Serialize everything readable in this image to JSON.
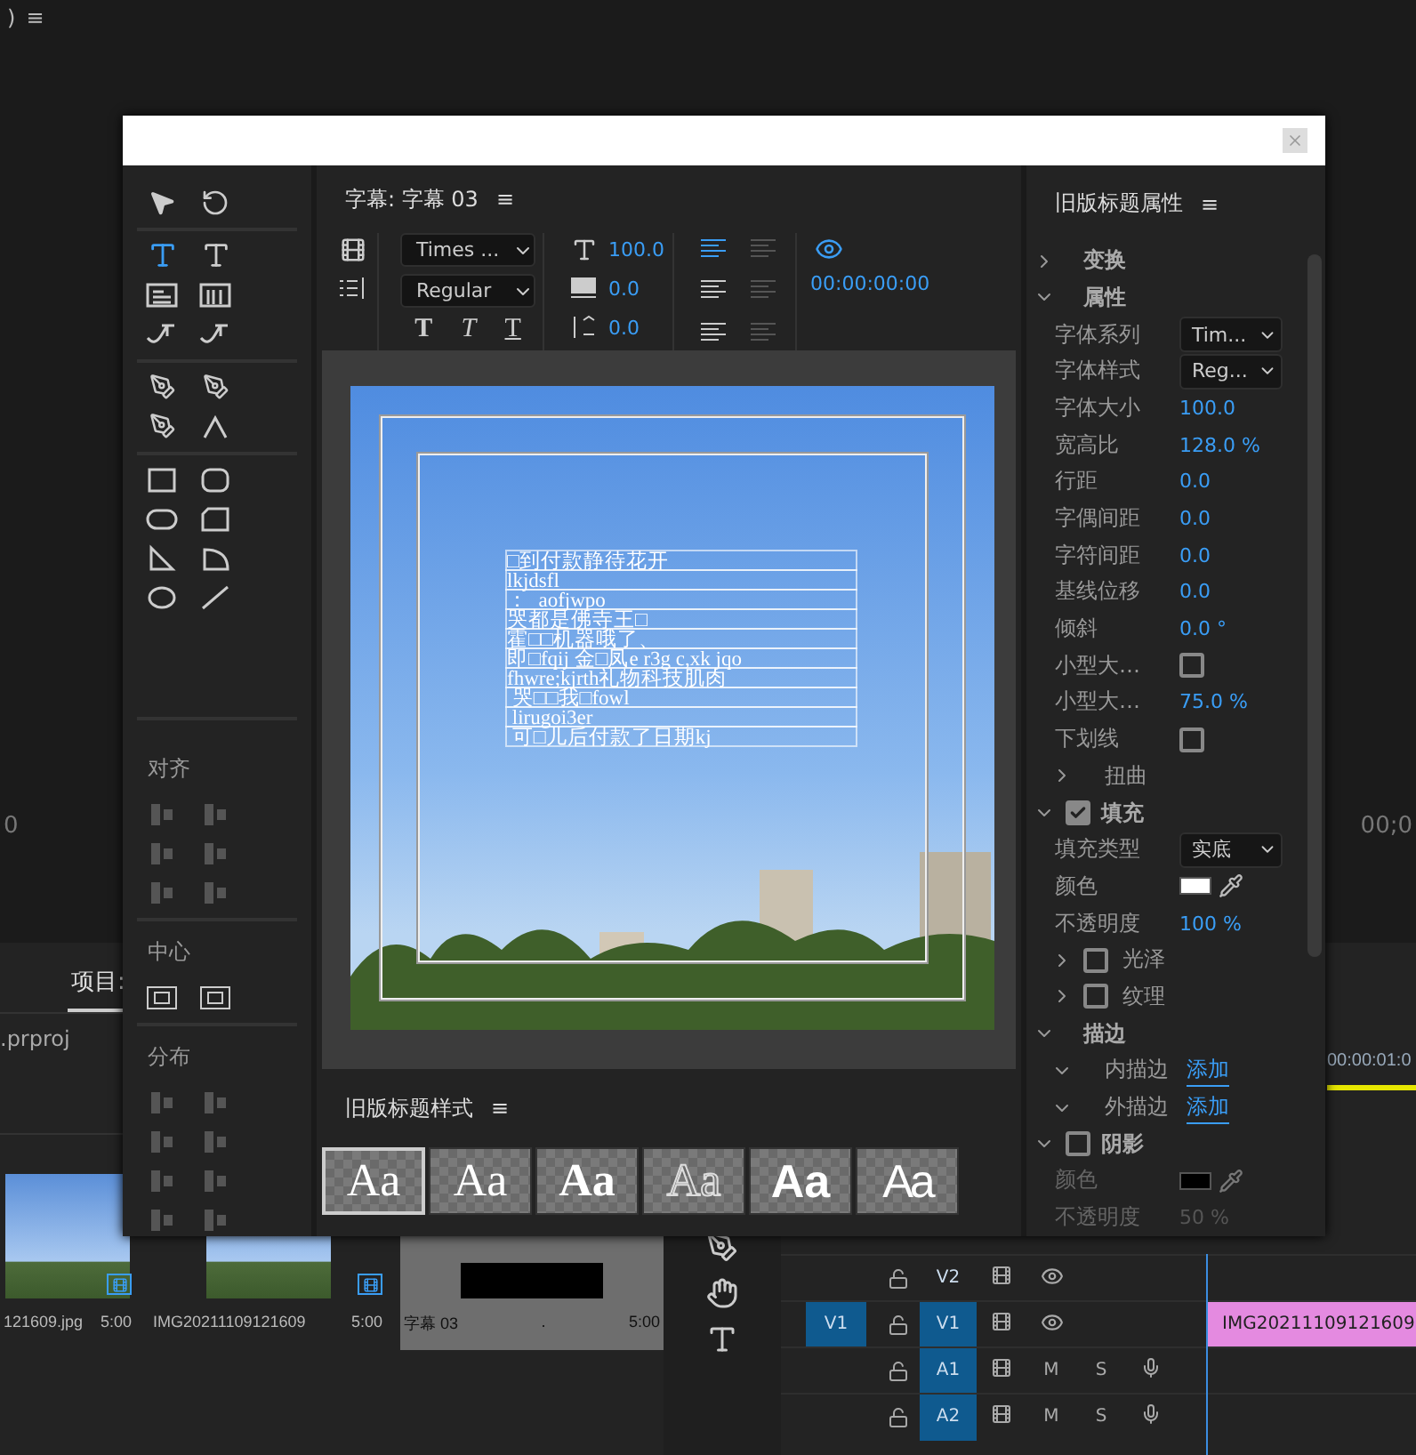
{
  "background": {
    "top_left": [
      ")",
      "≡"
    ],
    "left_timecode": "0",
    "right_timecode": "00;0",
    "project": {
      "tab": "项目:",
      "file": ".prproj",
      "items": [
        {
          "name": "121609.jpg",
          "duration": "5:00",
          "kind": "photo",
          "selected": false
        },
        {
          "name": "IMG20211109121609",
          "duration": "5:00",
          "kind": "photo",
          "selected": false
        },
        {
          "name": "字幕 03",
          "extra": ".",
          "duration": "5:00",
          "kind": "title",
          "selected": true
        }
      ]
    },
    "timeline": {
      "time": "00:00:01:0",
      "tracks": [
        {
          "label": "V2",
          "kind": "video",
          "targeted": false
        },
        {
          "source": "V1",
          "label": "V1",
          "kind": "video",
          "targeted": true,
          "clip": "IMG20211109121609"
        },
        {
          "label": "A1",
          "kind": "audio",
          "targeted": true,
          "mute": "M",
          "solo": "S"
        },
        {
          "label": "A2",
          "kind": "audio",
          "targeted": true,
          "mute": "M",
          "solo": "S"
        }
      ]
    }
  },
  "dialog": {
    "title_panel": {
      "title": "字幕: 字幕 03",
      "menu": "≡",
      "font_family": "Times ...",
      "font_style": "Regular",
      "style_buttons": [
        {
          "kind": "bold",
          "label": "T"
        },
        {
          "kind": "italic",
          "label": "T"
        },
        {
          "kind": "underline",
          "label": "T"
        }
      ],
      "size": "100.0",
      "kerning": "0.0",
      "leading": "0.0",
      "timecode": "00:00:00:00",
      "lines": [
        "□到付款静待花开",
        "lkjdsfl",
        "：  aofjwpo",
        "哭都是佛寺王□",
        "霍□□机器哦了、",
        "即□fqij 金□凤e r3g c,xk jqo",
        "fhwre;kjrth礼物科技肌肉",
        " 哭□□我□fowl",
        " lirugoi3er",
        " 可□儿后付款了日期kj"
      ]
    },
    "tools": {
      "align": "对齐",
      "center": "中心",
      "distribute": "分布"
    },
    "styles": {
      "title": "旧版标题样式",
      "menu": "≡",
      "swatches": [
        {
          "label": "Aa",
          "kind": "serif",
          "selected": true
        },
        {
          "label": "Aa",
          "kind": "serif",
          "selected": false
        },
        {
          "label": "Aa",
          "kind": "bold-serif",
          "selected": false
        },
        {
          "label": "Aa",
          "kind": "outline",
          "selected": false
        },
        {
          "label": "Aa",
          "kind": "sans",
          "selected": false
        },
        {
          "label": "Aa",
          "kind": "condensed",
          "selected": false
        }
      ]
    },
    "properties": {
      "title": "旧版标题属性",
      "menu": "≡",
      "rows": [
        {
          "kind": "section",
          "label": "变换",
          "expanded": false
        },
        {
          "kind": "section",
          "label": "属性",
          "expanded": true
        },
        {
          "kind": "dropdown",
          "label": "字体系列",
          "value": "Tim..."
        },
        {
          "kind": "dropdown",
          "label": "字体样式",
          "value": "Reg..."
        },
        {
          "kind": "number",
          "label": "字体大小",
          "value": "100.0"
        },
        {
          "kind": "number",
          "label": "宽高比",
          "value": "128.0 %"
        },
        {
          "kind": "number",
          "label": "行距",
          "value": "0.0"
        },
        {
          "kind": "number",
          "label": "字偶间距",
          "value": "0.0"
        },
        {
          "kind": "number",
          "label": "字符间距",
          "value": "0.0"
        },
        {
          "kind": "number",
          "label": "基线位移",
          "value": "0.0"
        },
        {
          "kind": "number",
          "label": "倾斜",
          "value": "0.0 °"
        },
        {
          "kind": "checkbox",
          "label": "小型大…",
          "checked": false
        },
        {
          "kind": "number",
          "label": "小型大…",
          "value": "75.0 %"
        },
        {
          "kind": "checkbox",
          "label": "下划线",
          "checked": false
        },
        {
          "kind": "subsection",
          "label": "扭曲",
          "expanded": false
        },
        {
          "kind": "section",
          "label": "填充",
          "expanded": true,
          "checked": true
        },
        {
          "kind": "dropdown",
          "label": "填充类型",
          "value": "实底"
        },
        {
          "kind": "color",
          "label": "颜色",
          "color": "#ffffff",
          "disabled": false
        },
        {
          "kind": "number",
          "label": "不透明度",
          "value": "100 %"
        },
        {
          "kind": "subsection",
          "label": "光泽",
          "expanded": false,
          "checked": false
        },
        {
          "kind": "subsection",
          "label": "纹理",
          "expanded": false,
          "checked": false
        },
        {
          "kind": "section",
          "label": "描边",
          "expanded": true
        },
        {
          "kind": "link",
          "label": "内描边",
          "value": "添加",
          "expanded": true
        },
        {
          "kind": "link",
          "label": "外描边",
          "value": "添加",
          "expanded": true
        },
        {
          "kind": "section",
          "label": "阴影",
          "expanded": true,
          "checked": false
        },
        {
          "kind": "color",
          "label": "颜色",
          "color": "#000000",
          "disabled": true
        },
        {
          "kind": "number",
          "label": "不透明度",
          "value": "50 %",
          "disabled": true
        }
      ]
    }
  }
}
